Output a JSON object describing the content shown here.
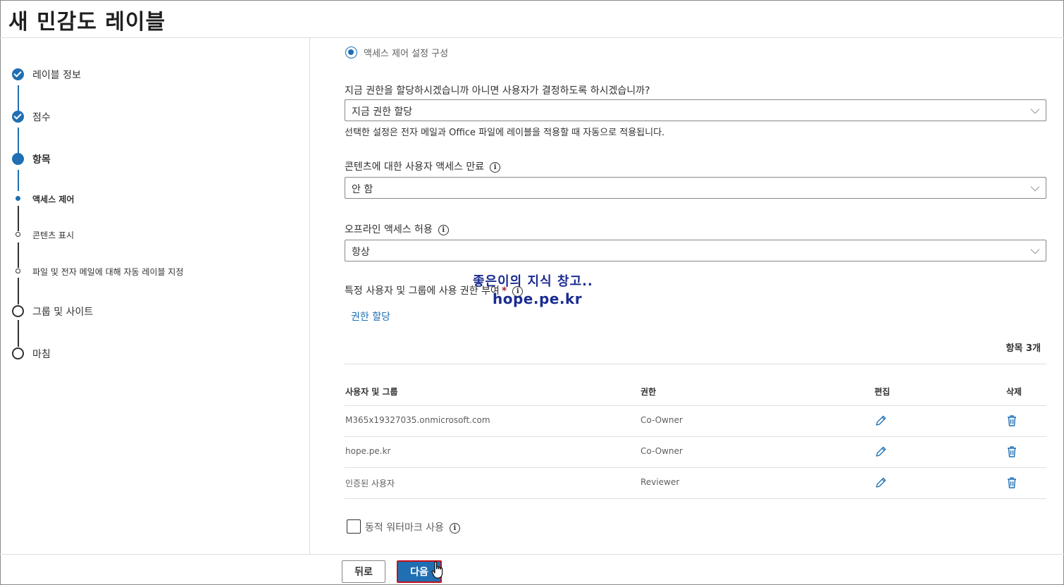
{
  "page": {
    "title": "새 민감도 레이블"
  },
  "sidebar": {
    "steps": [
      {
        "label": "레이블 정보"
      },
      {
        "label": "점수"
      },
      {
        "label": "항목"
      },
      {
        "label": "액세스 제어"
      },
      {
        "label": "콘텐츠 표시"
      },
      {
        "label": "파일 및 전자 메일에 대해 자동 레이블 지정"
      },
      {
        "label": "그룹 및 사이트"
      },
      {
        "label": "마침"
      }
    ]
  },
  "main": {
    "radio_label": "액세스 제어 설정 구성",
    "assign_question": "지금 권한을 할당하시겠습니까 아니면 사용자가 결정하도록 하시겠습니까?",
    "assign_value": "지금 권한 할당",
    "assign_hint": "선택한 설정은 전자 메일과 Office 파일에 레이블을 적용할 때 자동으로 적용됩니다.",
    "expiry_label": "콘텐츠에 대한 사용자 액세스 만료",
    "expiry_value": "안 함",
    "offline_label": "오프라인 액세스 허용",
    "offline_value": "항상",
    "grant_label": "특정 사용자 및 그룹에 사용 권한 부여",
    "required_mark": "*",
    "assign_link": "권한 할당",
    "item_count": "항목 3개",
    "table": {
      "headers": {
        "user": "사용자 및 그룹",
        "permission": "권한",
        "edit": "편집",
        "delete": "삭제"
      },
      "rows": [
        {
          "user": "M365x19327035.onmicrosoft.com",
          "permission": "Co-Owner"
        },
        {
          "user": "hope.pe.kr",
          "permission": "Co-Owner"
        },
        {
          "user": "인증된 사용자",
          "permission": "Reviewer"
        }
      ]
    },
    "watermark_checkbox": "동적 워터마크 사용",
    "watermark_checked": false
  },
  "overlay": {
    "line1": "좋은이의 지식 창고..",
    "line2": "hope.pe.kr"
  },
  "footer": {
    "back_label": "뒤로",
    "next_label": "다음"
  },
  "colors": {
    "accent": "#1f6fb2",
    "highlight_border": "#c50f1f",
    "overlay_text": "#1b2c8f"
  },
  "icons": {
    "info": "info-icon",
    "edit": "pencil-icon",
    "delete": "trash-icon",
    "dropdown": "chevron-down-icon",
    "cursor": "hand-cursor-icon"
  }
}
